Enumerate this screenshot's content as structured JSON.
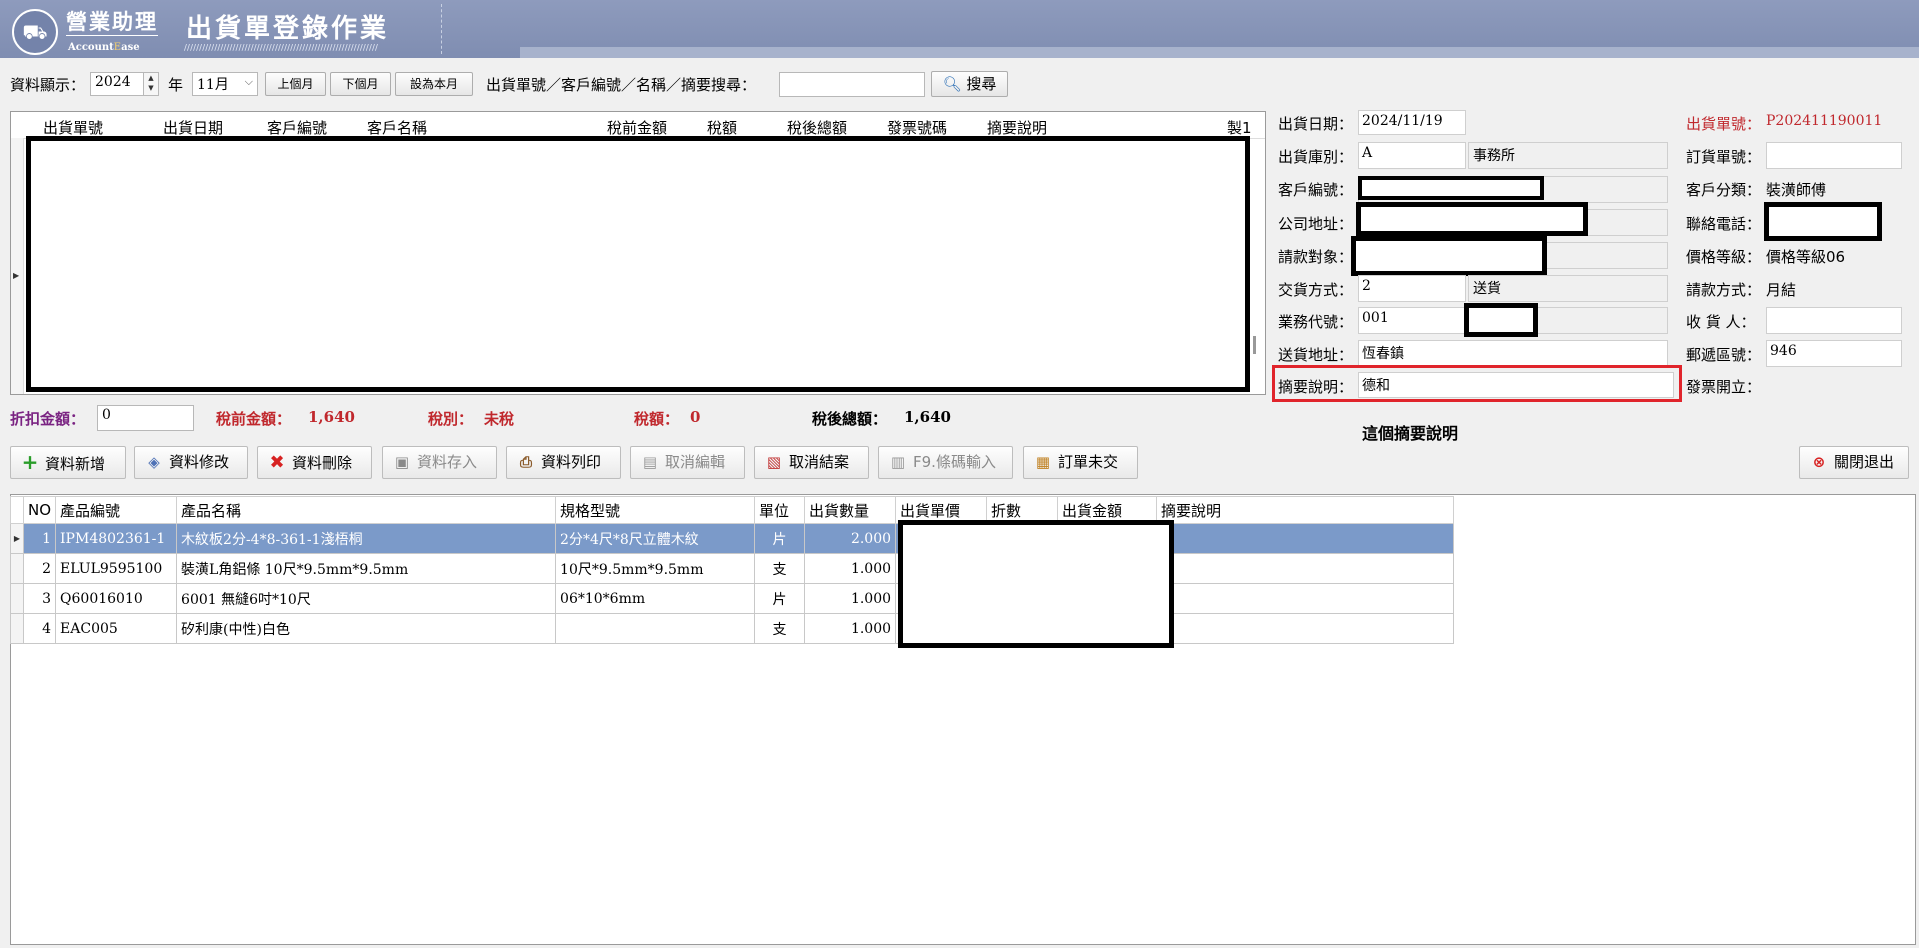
{
  "header": {
    "brand_cn": "營業助理",
    "brand_en_prefix": "Account",
    "brand_en_accent": "E",
    "brand_en_suffix": "ase",
    "title": "出貨單登錄作業",
    "title_decoration": "////////////////////////////////////////////////////////////////"
  },
  "toolbar": {
    "display_label": "資料顯示：",
    "year": "2024",
    "year_label": "年",
    "month": "11月",
    "prev_month": "上個月",
    "next_month": "下個月",
    "this_month": "設為本月",
    "search_label": "出貨單號／客戶編號／名稱／摘要搜尋：",
    "search_value": "",
    "search_button": "搜尋"
  },
  "list_grid": {
    "columns": [
      "出貨單號",
      "出貨日期",
      "客戶編號",
      "客戶名稱",
      "稅前金額",
      "稅額",
      "稅後總額",
      "發票號碼",
      "摘要說明",
      "製1"
    ]
  },
  "totals": {
    "discount_label": "折扣金額：",
    "discount_value": "0",
    "pretax_label": "稅前金額：",
    "pretax_value": "1,640",
    "taxtype_label": "稅別：",
    "taxtype_value": "未稅",
    "tax_label": "稅額：",
    "tax_value": "0",
    "aftertax_label": "稅後總額：",
    "aftertax_value": "1,640"
  },
  "form": {
    "ship_date_label": "出貨日期：",
    "ship_date": "2024/11/19",
    "order_no_label": "出貨單號：",
    "order_no": "P202411190011",
    "warehouse_label": "出貨庫別：",
    "warehouse_code": "A",
    "warehouse_name": "事務所",
    "po_label": "訂貨單號：",
    "po_value": "",
    "customer_id_label": "客戶編號：",
    "customer_class_label": "客戶分類：",
    "customer_class": "裝潢師傅",
    "address_label": "公司地址：",
    "phone_label": "聯絡電話：",
    "billing_label": "請款對象：",
    "price_level_label": "價格等級：",
    "price_level": "價格等級06",
    "delivery_label": "交貨方式：",
    "delivery_code": "2",
    "delivery_name": "送貨",
    "payment_label": "請款方式：",
    "payment": "月結",
    "sales_label": "業務代號：",
    "sales_code": "001",
    "receiver_label": "收 貨 人：",
    "receiver": "",
    "ship_addr_label": "送貨地址：",
    "ship_addr": "恆春鎮",
    "zip_label": "郵遞區號：",
    "zip": "946",
    "memo_label": "摘要說明：",
    "memo": "德和",
    "invoice_label": "發票開立：",
    "annotation": "這個摘要說明"
  },
  "actions": {
    "add": "資料新增",
    "edit": "資料修改",
    "delete": "資料刪除",
    "save": "資料存入",
    "print": "資料列印",
    "cancel_edit": "取消編輯",
    "cancel_close": "取消結案",
    "barcode": "F9.條碼輸入",
    "order_pending": "訂單未交",
    "close": "關閉退出"
  },
  "detail": {
    "columns": [
      "NO",
      "產品編號",
      "產品名稱",
      "規格型號",
      "單位",
      "出貨數量",
      "出貨單價",
      "折數",
      "出貨金額",
      "摘要說明"
    ],
    "rows": [
      {
        "no": "1",
        "code": "IPM4802361-1",
        "name": "木紋板2分-4*8-361-1淺梧桐",
        "spec": "2分*4尺*8尺立體木紋",
        "unit": "片",
        "qty": "2.000"
      },
      {
        "no": "2",
        "code": "ELUL9595100",
        "name": "裝潢L角鋁條 10尺*9.5mm*9.5mm",
        "spec": "10尺*9.5mm*9.5mm",
        "unit": "支",
        "qty": "1.000"
      },
      {
        "no": "3",
        "code": "Q60016010",
        "name": "6001 無縫6吋*10尺",
        "spec": "06*10*6mm",
        "unit": "片",
        "qty": "1.000"
      },
      {
        "no": "4",
        "code": "EAC005",
        "name": "矽利康(中性)白色",
        "spec": "",
        "unit": "支",
        "qty": "1.000"
      }
    ]
  },
  "colors": {
    "header_bg": "#8392b6",
    "selected_row": "#7b9ac9",
    "label_red": "#c0282d",
    "discount_purple": "#7a2382",
    "highlight_box": "#e0242b"
  }
}
